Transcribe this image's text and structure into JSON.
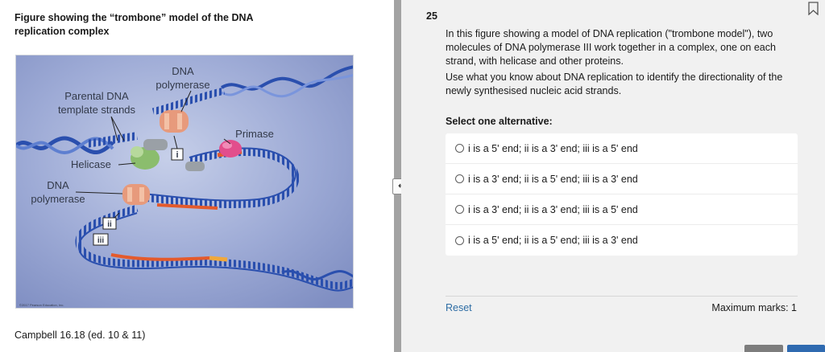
{
  "left": {
    "title": "Figure showing the “trombone” model of the DNA replication complex",
    "caption": "Campbell 16.18 (ed. 10 & 11)",
    "figure": {
      "labels": {
        "dna_polymerase_top_1": "DNA",
        "dna_polymerase_top_2": "polymerase",
        "parental_1": "Parental DNA",
        "parental_2": "template strands",
        "primase": "Primase",
        "helicase": "Helicase",
        "dna_polymerase_left_1": "DNA",
        "dna_polymerase_left_2": "polymerase",
        "marker_i": "i",
        "marker_ii": "ii",
        "marker_iii": "iii",
        "copyright": "©2017 Pearson Education, Inc."
      },
      "colors": {
        "background": "#8f9fcd",
        "strand_blue": "#2a4fae",
        "helicase_green": "#8bbd6d",
        "polymerase_orange": "#e79a7c",
        "primase_pink": "#e24e8c",
        "new_strand_red": "#e45a2c",
        "rna_primer_orange": "#f1a83a"
      }
    }
  },
  "divider": {
    "handle_icon": "↔"
  },
  "right": {
    "question_number": "25",
    "paragraphs": [
      "In this figure showing a model of DNA replication (\"trombone model\"), two molecules of DNA polymerase III work together in a complex, one on each strand, with helicase and other proteins.",
      "Use what you know about DNA replication to identify the directionality of the newly synthesised nucleic acid strands."
    ],
    "select_label": "Select one alternative:",
    "options": [
      "i is a 5' end; ii is a 3' end; iii is a 5' end",
      "i is a 3' end; ii is a 5' end; iii is a 3' end",
      "i is a 3' end; ii is a 3' end; iii is a 5' end",
      "i is a 5' end; ii is a 5' end; iii is a 3' end"
    ],
    "reset_label": "Reset",
    "marks_label": "Maximum marks: 1"
  }
}
